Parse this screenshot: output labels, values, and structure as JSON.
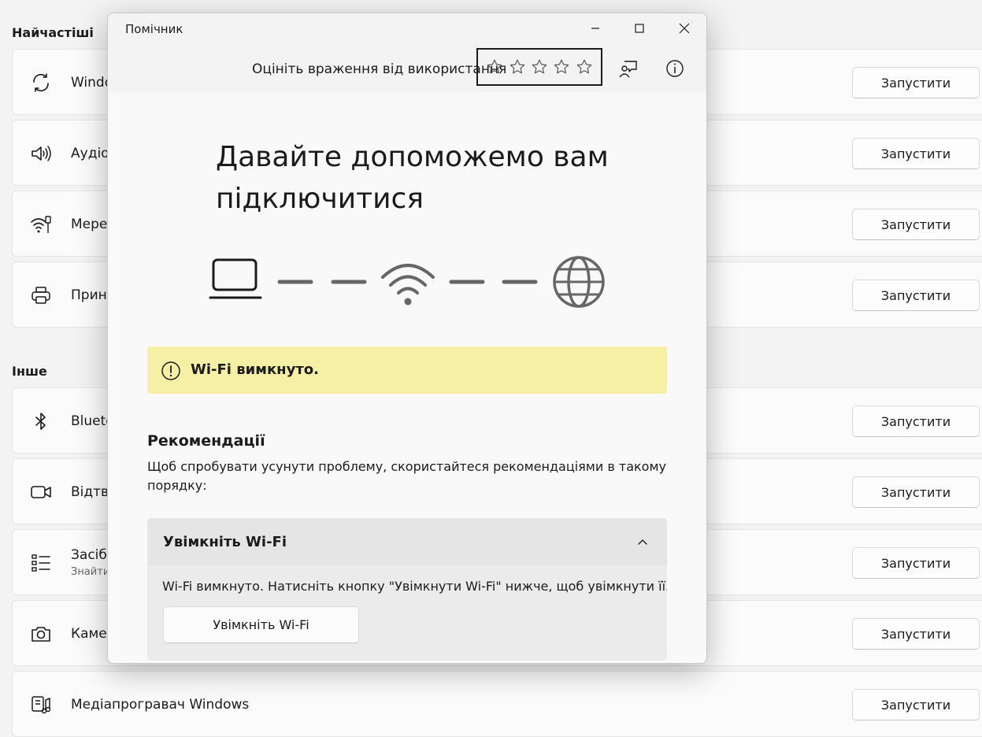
{
  "background": {
    "sections": [
      {
        "title": "Найчастіші"
      },
      {
        "title": "Інше"
      }
    ],
    "rows": [
      {
        "name": "Windo",
        "icon": "sync-icon"
      },
      {
        "name": "Аудіо",
        "icon": "speaker-icon"
      },
      {
        "name": "Мереж",
        "icon": "network-icon"
      },
      {
        "name": "Принт",
        "icon": "printer-icon"
      },
      {
        "name": "Blueto",
        "icon": "bluetooth-icon"
      },
      {
        "name": "Відтво",
        "icon": "video-icon"
      },
      {
        "name": "Засіб",
        "sub": "Знайти",
        "icon": "list-icon"
      },
      {
        "name": "Камер",
        "icon": "camera-icon"
      },
      {
        "name": "Медіапрогравач Windows",
        "icon": "media-player-icon"
      }
    ],
    "run_label": "Запустити"
  },
  "dialog": {
    "title": "Помічник",
    "rate_label": "Оцініть враження від використання",
    "stars_count": 5,
    "hero": "Давайте допоможемо вам підключитися",
    "banner": {
      "text": "Wi-Fi вимкнуто.",
      "color": "#f5f0a6"
    },
    "recommendations": {
      "title": "Рекомендації",
      "description": "Щоб спробувати усунути проблему, скористайтеся рекомендаціями в такому порядку:"
    },
    "accordion": {
      "title": "Увімкніть Wi-Fi",
      "expanded": true,
      "text": "Wi-Fi вимкнуто. Натисніть кнопку \"Увімкнути Wi-Fi\" нижче, щоб увімкнути її.",
      "button_label": "Увімкніть Wi-Fi"
    }
  }
}
